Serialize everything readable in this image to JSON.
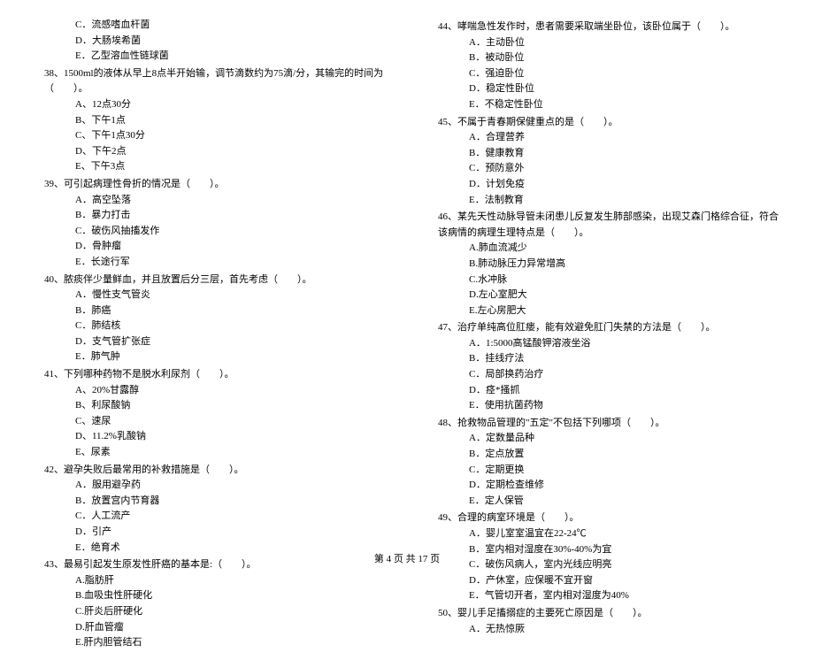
{
  "left": {
    "q37_options": [
      "C．流感嗜血杆菌",
      "D．大肠埃希菌",
      "E．乙型溶血性链球菌"
    ],
    "q38": {
      "stem": "38、1500ml的液体从早上8点半开始输，调节滴数约为75滴/分，其输完的时间为（　　）。",
      "options": [
        "A、12点30分",
        "B、下午1点",
        "C、下午1点30分",
        "D、下午2点",
        "E、下午3点"
      ]
    },
    "q39": {
      "stem": "39、可引起病理性骨折的情况是（　　）。",
      "options": [
        "A．高空坠落",
        "B．暴力打击",
        "C．破伤风抽搐发作",
        "D．骨肿瘤",
        "E．长途行军"
      ]
    },
    "q40": {
      "stem": "40、脓痰伴少量鲜血，并且放置后分三层，首先考虑（　　）。",
      "options": [
        "A．慢性支气管炎",
        "B．肺癌",
        "C．肺结核",
        "D．支气管扩张症",
        "E．肺气肿"
      ]
    },
    "q41": {
      "stem": "41、下列哪种药物不是脱水利尿剂（　　）。",
      "options": [
        "A、20%甘露醇",
        "B、利尿酸钠",
        "C、速尿",
        "D、11.2%乳酸钠",
        "E、尿素"
      ]
    },
    "q42": {
      "stem": "42、避孕失败后最常用的补救措施是（　　）。",
      "options": [
        "A．服用避孕药",
        "B．放置宫内节育器",
        "C．人工流产",
        "D．引产",
        "E．绝育术"
      ]
    },
    "q43": {
      "stem": "43、最易引起发生原发性肝癌的基本是:（　　）。",
      "options": [
        "A.脂肪肝",
        "B.血吸虫性肝硬化",
        "C.肝炎后肝硬化",
        "D.肝血管瘤",
        "E.肝内胆管结石"
      ]
    }
  },
  "right": {
    "q44": {
      "stem": "44、哮喘急性发作时，患者需要采取端坐卧位，该卧位属于（　　）。",
      "options": [
        "A．主动卧位",
        "B．被动卧位",
        "C．强迫卧位",
        "D．稳定性卧位",
        "E．不稳定性卧位"
      ]
    },
    "q45": {
      "stem": "45、不属于青春期保健重点的是（　　）。",
      "options": [
        "A．合理营养",
        "B．健康教育",
        "C．预防意外",
        "D．计划免疫",
        "E．法制教育"
      ]
    },
    "q46": {
      "stem": "46、某先天性动脉导管未闭患儿反复发生肺部感染，出现艾森门格综合征，符合该病情的病理生理特点是（　　）。",
      "options": [
        "A.肺血流减少",
        "B.肺动脉压力异常增高",
        "C.水冲脉",
        "D.左心室肥大",
        "E.左心房肥大"
      ]
    },
    "q47": {
      "stem": "47、治疗单纯高位肛瘘，能有效避免肛门失禁的方法是（　　）。",
      "options": [
        "A．1:5000高锰酸钾溶液坐浴",
        "B．挂线疗法",
        "C．局部换药治疗",
        "D．痉*搔抓",
        "E．使用抗菌药物"
      ]
    },
    "q48": {
      "stem": "48、抢救物品管理的\"五定\"不包括下列哪项（　　）。",
      "options": [
        "A．定数量品种",
        "B．定点放置",
        "C．定期更换",
        "D．定期检查维修",
        "E．定人保管"
      ]
    },
    "q49": {
      "stem": "49、合理的病室环境是（　　）。",
      "options": [
        "A．婴儿室室温宜在22-24℃",
        "B．室内相对湿度在30%-40%为宜",
        "C．破伤风病人，室内光线应明亮",
        "D．产休室，应保暖不宜开窗",
        "E．气管切开者，室内相对湿度为40%"
      ]
    },
    "q50": {
      "stem": "50、婴儿手足搐搦症的主要死亡原因是（　　）。",
      "options": [
        "A．无热惊厥"
      ]
    }
  },
  "footer": "第 4 页 共 17 页"
}
